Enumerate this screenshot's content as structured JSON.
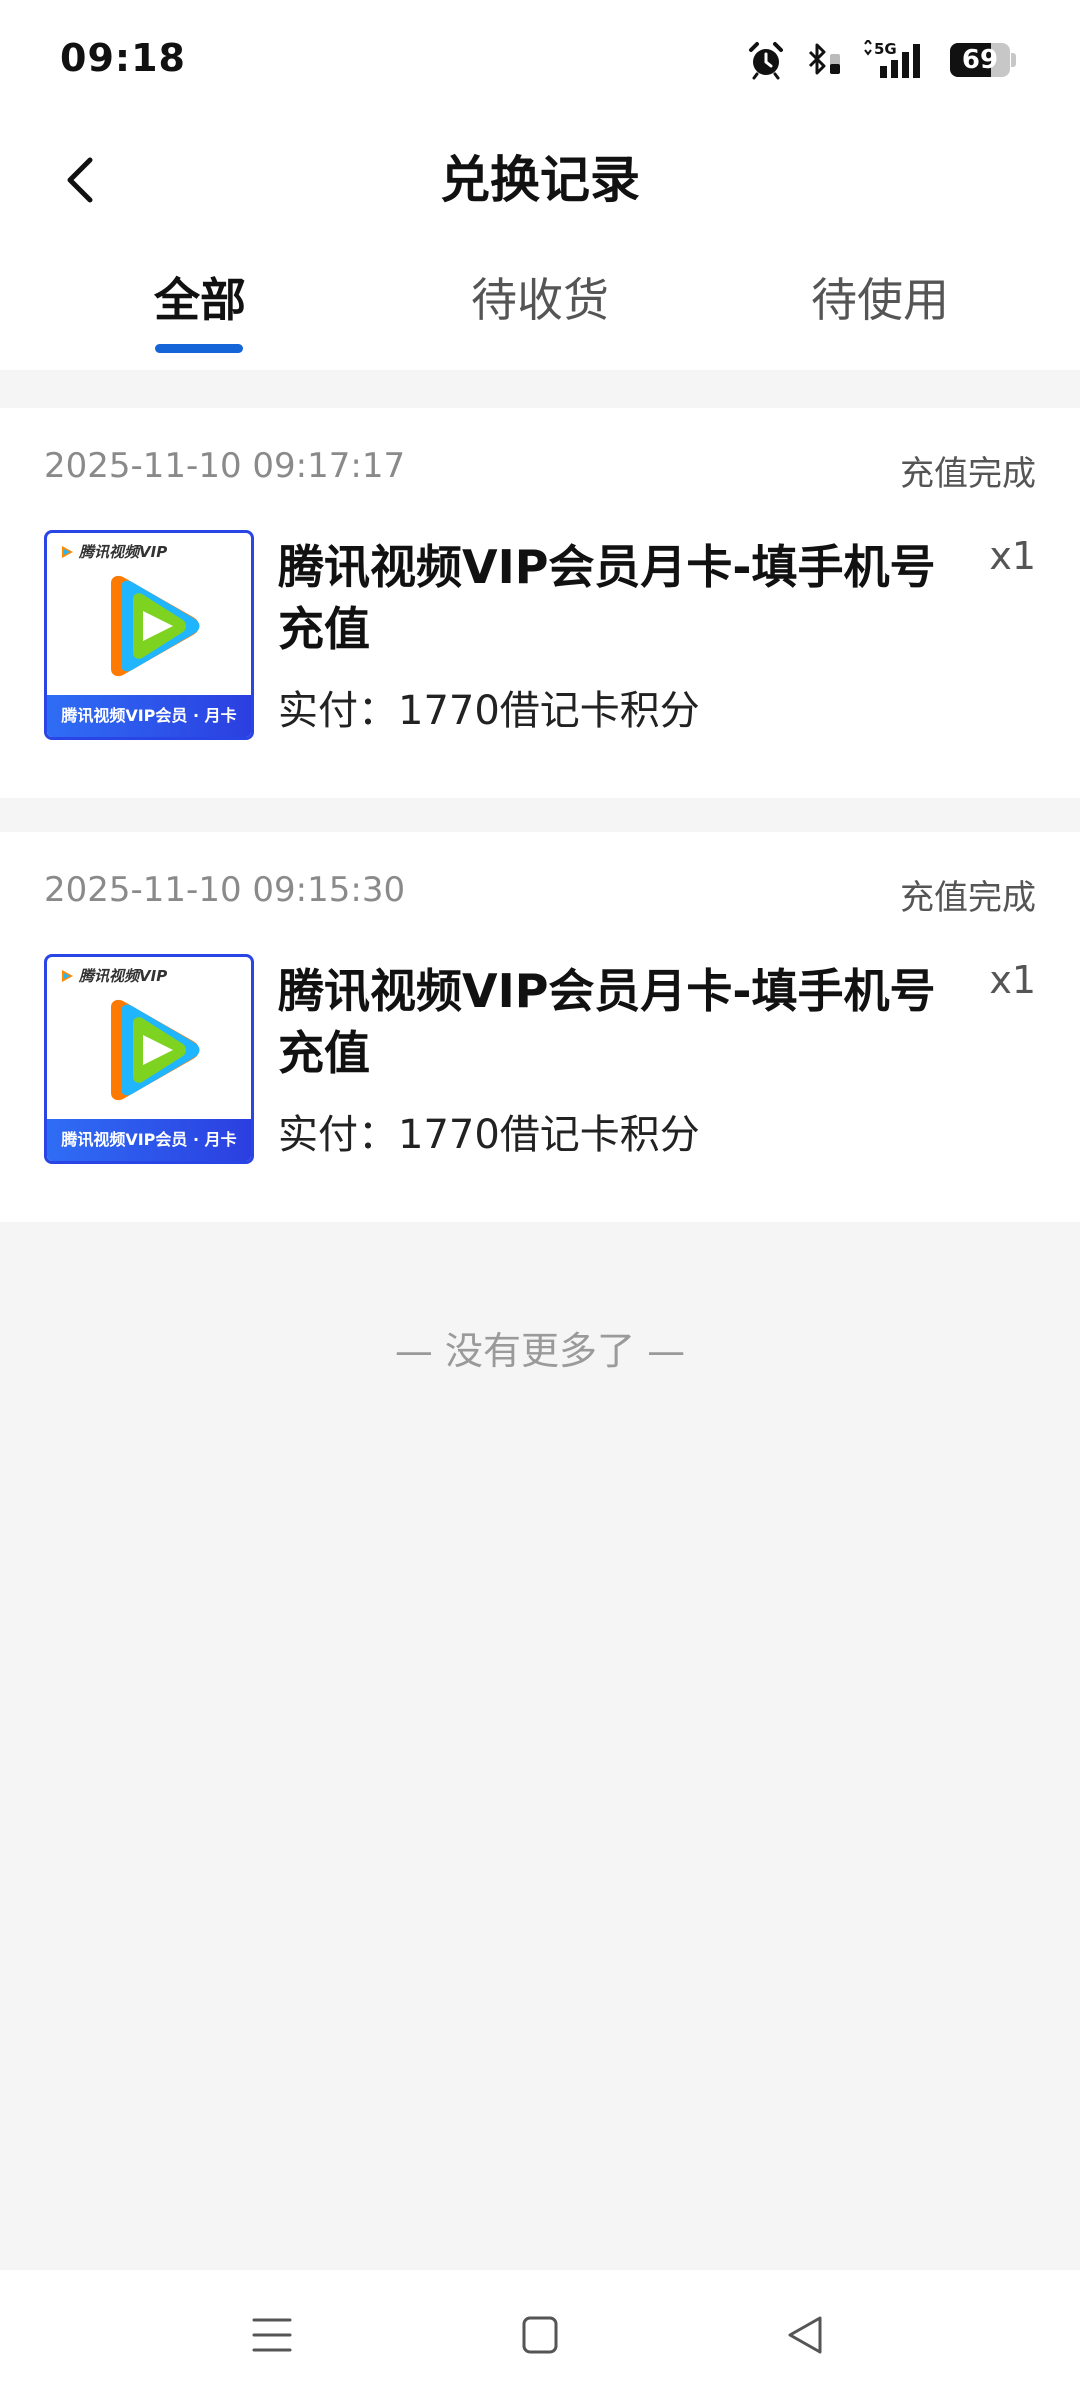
{
  "status_bar": {
    "time": "09:18",
    "network": "5G",
    "battery": 69,
    "battery_label": "69"
  },
  "header": {
    "title": "兑换记录",
    "back_icon": "chevron-left-icon"
  },
  "tabs": [
    {
      "label": "全部",
      "active": true
    },
    {
      "label": "待收货",
      "active": false
    },
    {
      "label": "待使用",
      "active": false
    }
  ],
  "orders": [
    {
      "date": "2025-11-10 09:17:17",
      "status": "充值完成",
      "thumb_brand": "腾讯视频VIP",
      "thumb_band": "腾讯视频VIP会员 · 月卡",
      "name_line1": "腾讯视频VIP会员月卡-填手机号",
      "name_line2": "充值",
      "quantity": "x1",
      "paid": "实付：1770借记卡积分"
    },
    {
      "date": "2025-11-10 09:15:30",
      "status": "充值完成",
      "thumb_brand": "腾讯视频VIP",
      "thumb_band": "腾讯视频VIP会员 · 月卡",
      "name_line1": "腾讯视频VIP会员月卡-填手机号",
      "name_line2": "充值",
      "quantity": "x1",
      "paid": "实付：1770借记卡积分"
    }
  ],
  "footer_text": "— 没有更多了 —",
  "colors": {
    "accent": "#1565d8",
    "background": "#f5f5f5",
    "thumb_border": "#2a45e6"
  }
}
